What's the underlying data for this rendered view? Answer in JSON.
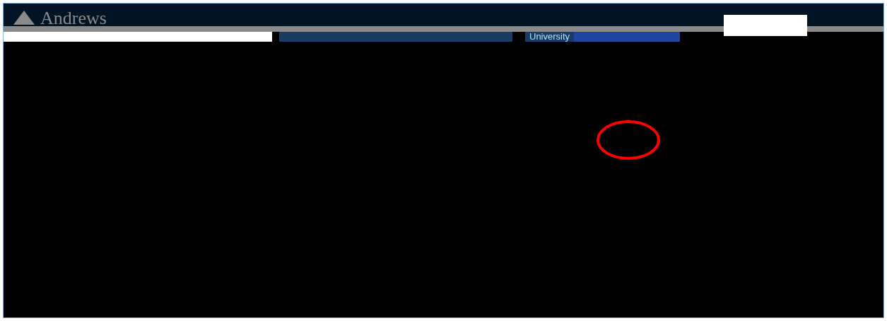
{
  "header": {
    "logo_text": "Andrews"
  },
  "nav_bar": {
    "label": "University"
  }
}
